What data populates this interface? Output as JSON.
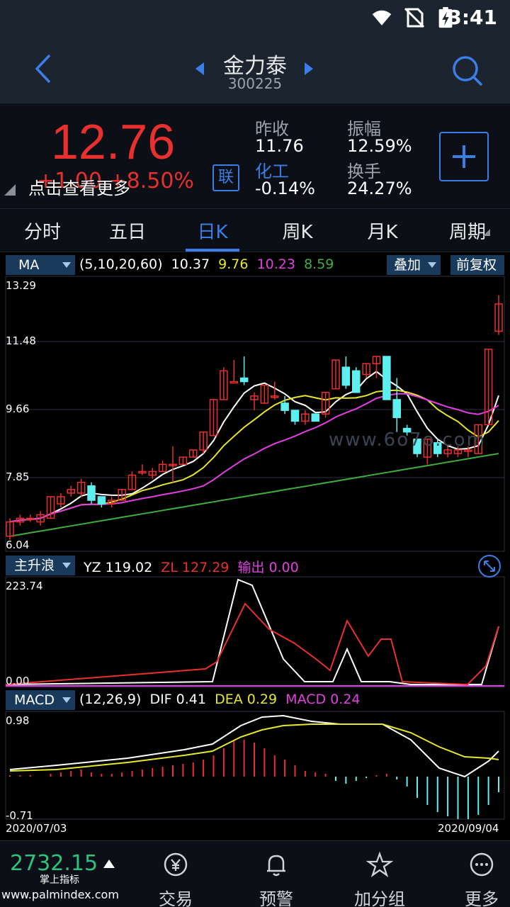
{
  "status": {
    "time": "3:41"
  },
  "header": {
    "title": "金力泰",
    "code": "300225"
  },
  "quote": {
    "price": "12.76",
    "change": "+1.00",
    "change_pct": "+8.50%",
    "tip": "点击查看更多",
    "badge": "联",
    "prev_close_label": "昨收",
    "prev_close": "11.76",
    "sector_label": "化工",
    "sector_change": "-0.14%",
    "amplitude_label": "振幅",
    "amplitude": "12.59%",
    "turnover_label": "换手",
    "turnover": "24.27%"
  },
  "tabs": [
    "分时",
    "五日",
    "日K",
    "周K",
    "月K",
    "周期"
  ],
  "active_tab": 2,
  "ma_bar": {
    "selector": "MA",
    "params": "(5,10,20,60)",
    "values": [
      "10.37",
      "9.76",
      "10.23",
      "8.59"
    ],
    "overlay": "叠加",
    "adjust": "前复权"
  },
  "ind_bar": {
    "selector": "主升浪",
    "yz_label": "YZ",
    "yz": "119.02",
    "zl_label": "ZL",
    "zl": "127.29",
    "out_label": "输出",
    "out": "0.00"
  },
  "macd_bar": {
    "selector": "MACD",
    "params": "(12,26,9)",
    "dif_label": "DIF",
    "dif": "0.41",
    "dea_label": "DEA",
    "dea": "0.29",
    "macd_label": "MACD",
    "macd": "0.24"
  },
  "axes": {
    "price": [
      "13.29",
      "11.48",
      "9.66",
      "7.85",
      "6.04"
    ],
    "ind": [
      "223.74",
      "0.00"
    ],
    "macd": [
      "0.98",
      "-0.71"
    ],
    "date_start": "2020/07/03",
    "date_end": "2020/09/04"
  },
  "watermark": "www.6o7o.com",
  "watermark2": "掌上指标",
  "watermark3": "www.palmindex.com",
  "colors": {
    "up": "#e8302e",
    "down": "#5ef0f0",
    "accent": "#3b7ee6",
    "ma5": "#ffffff",
    "ma10": "#e6e62a",
    "ma20": "#e23fe2",
    "ma60": "#3fae3f"
  },
  "chart_data": {
    "type": "candlestick",
    "price_ylim": [
      6.04,
      13.29
    ],
    "candles": [
      [
        6.3,
        6.7,
        6.2,
        6.8
      ],
      [
        6.7,
        6.8,
        6.6,
        6.9
      ],
      [
        6.8,
        6.8,
        6.7,
        6.9
      ],
      [
        6.7,
        6.9,
        6.6,
        7.0
      ],
      [
        6.8,
        7.4,
        6.8,
        7.4
      ],
      [
        7.2,
        7.4,
        7.1,
        7.5
      ],
      [
        7.5,
        7.6,
        7.4,
        7.7
      ],
      [
        7.5,
        7.8,
        7.4,
        7.9
      ],
      [
        7.7,
        7.3,
        7.2,
        7.8
      ],
      [
        7.4,
        7.2,
        7.1,
        7.4
      ],
      [
        7.2,
        7.3,
        7.1,
        7.4
      ],
      [
        7.3,
        7.6,
        7.3,
        7.6
      ],
      [
        7.6,
        8.0,
        7.6,
        8.1
      ],
      [
        8.1,
        8.1,
        8.0,
        8.3
      ],
      [
        8.0,
        8.1,
        7.9,
        8.2
      ],
      [
        8.1,
        8.3,
        8.1,
        8.4
      ],
      [
        8.3,
        8.3,
        7.8,
        8.8
      ],
      [
        8.3,
        8.5,
        8.3,
        8.5
      ],
      [
        8.5,
        8.7,
        8.5,
        8.7
      ],
      [
        8.7,
        9.2,
        8.6,
        9.2
      ],
      [
        9.1,
        10.1,
        9.1,
        10.1
      ],
      [
        10.1,
        10.9,
        10.1,
        11.0
      ],
      [
        10.6,
        10.6,
        10.6,
        11.2
      ],
      [
        10.7,
        10.6,
        10.5,
        11.3
      ],
      [
        10.1,
        10.2,
        9.8,
        10.3
      ],
      [
        10.0,
        10.5,
        10.0,
        10.5
      ],
      [
        10.2,
        10.2,
        10.1,
        10.6
      ],
      [
        10.0,
        9.8,
        9.7,
        10.2
      ],
      [
        9.8,
        9.5,
        9.4,
        9.8
      ],
      [
        9.5,
        9.7,
        9.4,
        9.8
      ],
      [
        9.7,
        9.5,
        9.5,
        9.7
      ],
      [
        9.7,
        10.3,
        9.6,
        10.3
      ],
      [
        10.4,
        11.2,
        10.4,
        11.2
      ],
      [
        11.0,
        10.5,
        10.4,
        11.3
      ],
      [
        10.9,
        10.3,
        10.3,
        11.0
      ],
      [
        10.8,
        11.1,
        10.7,
        11.1
      ],
      [
        11.1,
        11.3,
        10.7,
        11.3
      ],
      [
        11.3,
        10.1,
        10.1,
        11.3
      ],
      [
        10.1,
        9.6,
        9.2,
        10.7
      ],
      [
        9.3,
        9.2,
        9.1,
        9.4
      ],
      [
        9.0,
        8.6,
        8.5,
        9.0
      ],
      [
        8.5,
        9.0,
        8.3,
        9.0
      ],
      [
        8.9,
        8.6,
        8.5,
        9.0
      ],
      [
        8.6,
        8.7,
        8.5,
        8.8
      ],
      [
        8.6,
        8.7,
        8.5,
        8.8
      ],
      [
        8.7,
        8.7,
        8.5,
        8.8
      ],
      [
        8.6,
        9.4,
        8.6,
        9.4
      ],
      [
        9.4,
        11.5,
        9.4,
        11.5
      ],
      [
        12.0,
        12.76,
        11.9,
        13.0
      ]
    ]
  }
}
